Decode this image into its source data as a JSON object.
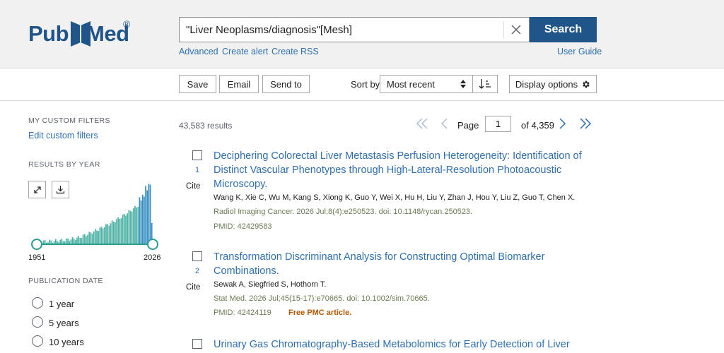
{
  "header": {
    "logo_pub": "Pub",
    "logo_med": "Med",
    "logo_reg": "®",
    "search_value": "\"Liver Neoplasms/diagnosis\"[Mesh]",
    "search_button": "Search",
    "links": {
      "advanced": "Advanced",
      "create_alert": "Create alert",
      "create_rss": "Create RSS",
      "user_guide": "User Guide"
    }
  },
  "toolbar": {
    "save": "Save",
    "email": "Email",
    "send_to": "Send to",
    "sort_label": "Sort by:",
    "sort_value": "Most recent",
    "display_options": "Display options"
  },
  "sidebar": {
    "custom_filters_head": "MY CUSTOM FILTERS",
    "edit_custom_filters": "Edit custom filters",
    "results_by_year_head": "RESULTS BY YEAR",
    "year_start": "1951",
    "year_end": "2026",
    "publication_date_head": "PUBLICATION DATE",
    "date_options": [
      "1 year",
      "5 years",
      "10 years"
    ]
  },
  "results": {
    "count": "43,583 results",
    "page_label": "Page",
    "page_value": "1",
    "of_pages": "of 4,359",
    "items": [
      {
        "num": "1",
        "cite": "Cite",
        "title": "Deciphering Colorectal Liver Metastasis Perfusion Heterogeneity: Identification of Distinct Vascular Phenotypes through High-Lateral-Resolution Photoacoustic Microscopy.",
        "authors": "Wang K, Xie C, Wu M, Kang S, Xiong K, Guo Y, Wei X, Hu H, Liu Y, Zhan J, Hou Y, Liu Z, Guo T, Chen X.",
        "journal": "Radiol Imaging Cancer. 2026 Jul;8(4):e250523. doi: 10.1148/rycan.250523.",
        "pmid": "PMID: 42429583"
      },
      {
        "num": "2",
        "cite": "Cite",
        "title": "Transformation Discriminant Analysis for Constructing Optimal Biomarker Combinations.",
        "authors": "Sewak A, Siegfried S, Hothorn T.",
        "journal": "Stat Med. 2026 Jul;45(15-17):e70665. doi: 10.1002/sim.70665.",
        "pmid": "PMID: 42424119",
        "free": "Free PMC article."
      },
      {
        "title": "Urinary Gas Chromatography-Based Metabolomics for Early Detection of Liver"
      }
    ]
  },
  "colors": {
    "brand": "#20558a",
    "link": "#2f6fb0",
    "journal": "#6a7d52",
    "free_pmc": "#b25700",
    "histogram": "#4fb3a6"
  }
}
